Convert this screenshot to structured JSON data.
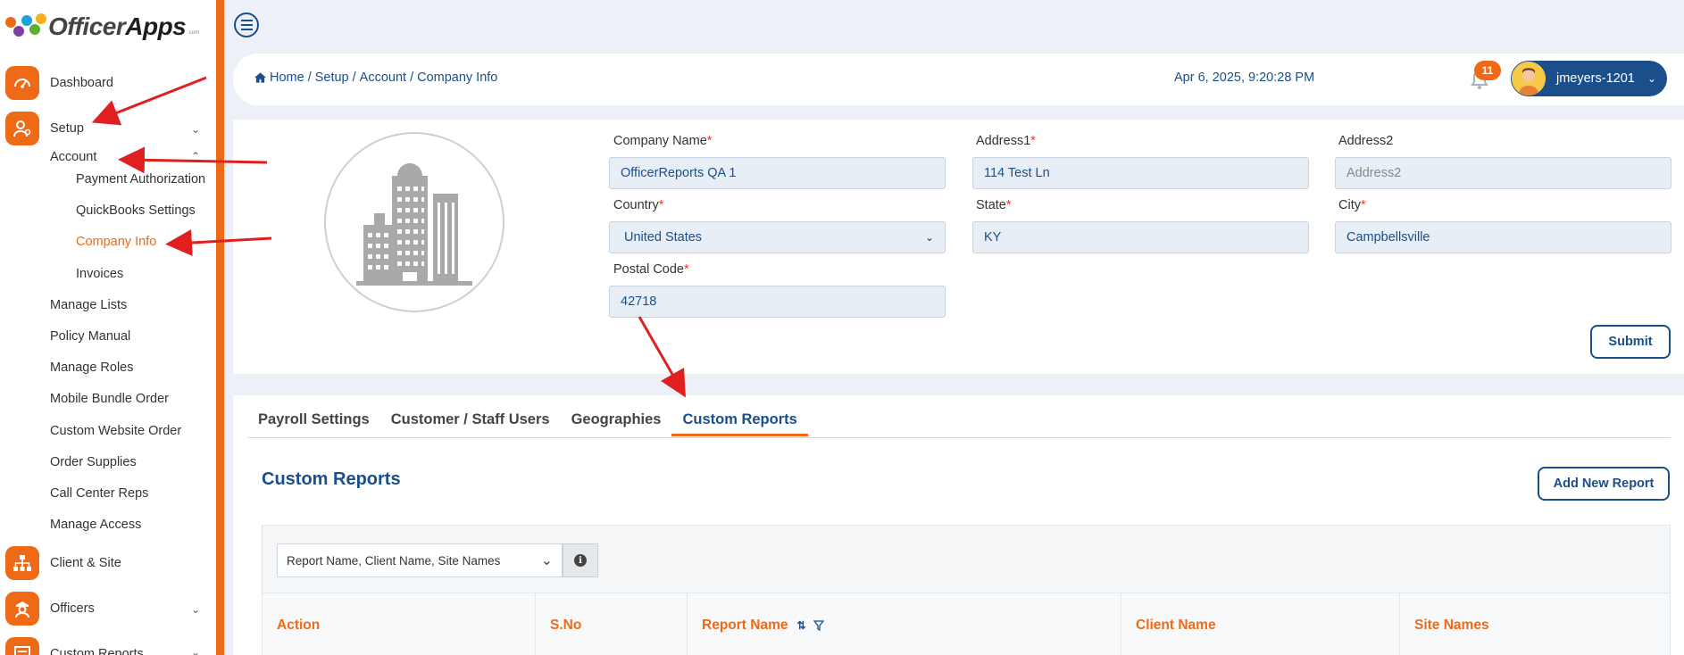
{
  "app": {
    "logo_main": "Officer",
    "logo_bold": "Apps",
    "logo_small": ".com"
  },
  "sidebar": {
    "dashboard": "Dashboard",
    "setup": "Setup",
    "account": "Account",
    "payment_authorization": "Payment Authorization",
    "quickbooks_settings": "QuickBooks Settings",
    "company_info": "Company Info",
    "invoices": "Invoices",
    "manage_lists": "Manage Lists",
    "policy_manual": "Policy Manual",
    "manage_roles": "Manage Roles",
    "mobile_bundle_order": "Mobile Bundle Order",
    "custom_website_order": "Custom Website Order",
    "order_supplies": "Order Supplies",
    "call_center_reps": "Call Center Reps",
    "manage_access": "Manage Access",
    "client_site": "Client & Site",
    "officers": "Officers",
    "custom_reports": "Custom Reports"
  },
  "header": {
    "breadcrumb": {
      "home": "Home",
      "sep": "/",
      "setup": "Setup",
      "account": "Account",
      "company_info": "Company Info"
    },
    "datetime": "Apr 6, 2025, 9:20:28 PM",
    "notification_count": "11",
    "user_name": "jmeyers-1201"
  },
  "company_form": {
    "company_name_label": "Company Name",
    "company_name_value": "OfficerReports QA 1",
    "address1_label": "Address1",
    "address1_value": "114 Test Ln",
    "address2_label": "Address2",
    "address2_placeholder": "Address2",
    "country_label": "Country",
    "country_value": "United States",
    "state_label": "State",
    "state_value": "KY",
    "city_label": "City",
    "city_value": "Campbellsville",
    "postal_code_label": "Postal Code",
    "postal_code_value": "42718",
    "required_mark": "*",
    "submit_label": "Submit"
  },
  "tabs": {
    "payroll_settings": "Payroll Settings",
    "customer_staff_users": "Customer / Staff Users",
    "geographies": "Geographies",
    "custom_reports": "Custom Reports"
  },
  "custom_reports": {
    "title": "Custom Reports",
    "add_button": "Add New Report",
    "filter_select": "Report Name, Client Name, Site Names",
    "info_glyph": "i",
    "columns": {
      "action": "Action",
      "sno": "S.No",
      "report_name": "Report Name",
      "client_name": "Client Name",
      "site_names": "Site Names"
    }
  },
  "colors": {
    "brand_orange": "#ee6a16",
    "brand_blue": "#1a4f8b"
  }
}
